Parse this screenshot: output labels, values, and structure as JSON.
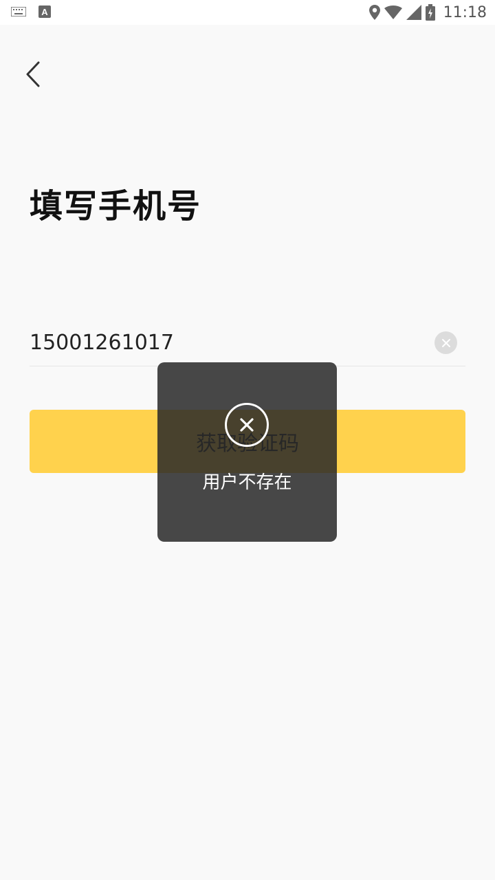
{
  "status_bar": {
    "time": "11:18",
    "icons": [
      "keyboard-icon",
      "a-icon",
      "location-icon",
      "wifi-icon",
      "signal-icon",
      "battery-charging-icon"
    ]
  },
  "header": {
    "back_icon": "chevron-left-icon"
  },
  "main": {
    "title": "填写手机号",
    "phone_input": {
      "value": "15001261017",
      "placeholder": ""
    },
    "clear_icon": "clear-icon",
    "primary_button_label": "获取验证码"
  },
  "toast": {
    "icon": "close-circle-icon",
    "message": "用户不存在"
  },
  "colors": {
    "accent": "#ffd24d",
    "background": "#f9f9f9",
    "toast_bg": "#282828"
  }
}
